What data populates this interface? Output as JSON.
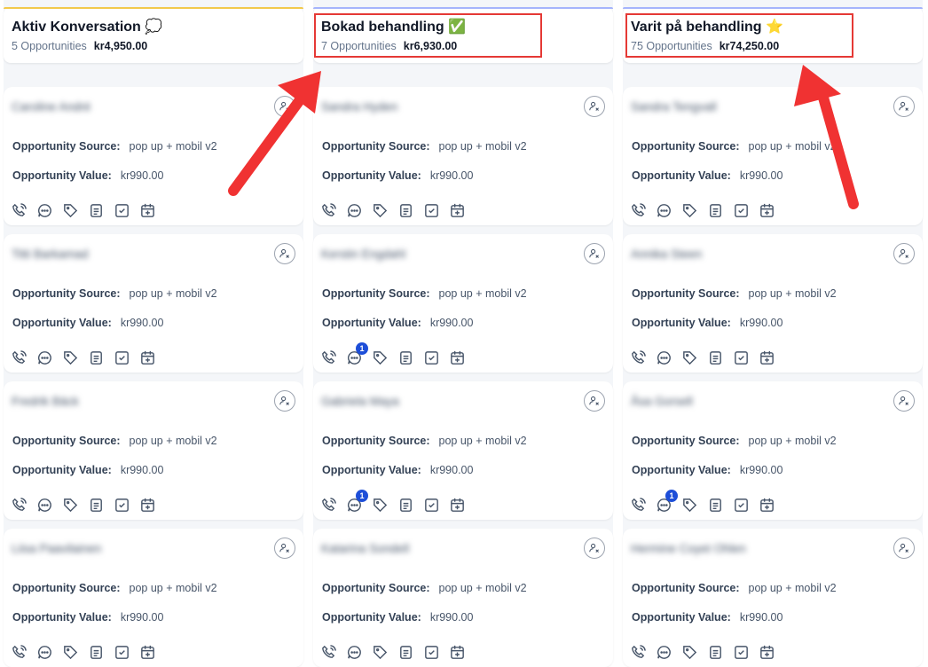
{
  "columns": [
    {
      "title": "Aktiv Konversation 💭",
      "count": "5 Opportunities",
      "total": "kr4,950.00",
      "accent": "#f2c94c",
      "cards": [
        {
          "name": "Caroline André",
          "source": "pop up + mobil v2",
          "value": "kr990.00",
          "badge": ""
        },
        {
          "name": "Titti Barkamad",
          "source": "pop up + mobil v2",
          "value": "kr990.00",
          "badge": ""
        },
        {
          "name": "Fredrik Bäck",
          "source": "pop up + mobil v2",
          "value": "kr990.00",
          "badge": ""
        },
        {
          "name": "Liisa Paavilainen",
          "source": "pop up + mobil v2",
          "value": "kr990.00",
          "badge": ""
        }
      ]
    },
    {
      "title": "Bokad behandling ✅",
      "count": "7 Opportunities",
      "total": "kr6,930.00",
      "accent": "#a5b4fc",
      "cards": [
        {
          "name": "Sandra Hyden",
          "source": "pop up + mobil v2",
          "value": "kr990.00",
          "badge": ""
        },
        {
          "name": "Kerstin Engdahl",
          "source": "pop up + mobil v2",
          "value": "kr990.00",
          "badge": "1"
        },
        {
          "name": "Gabriela Maya",
          "source": "pop up + mobil v2",
          "value": "kr990.00",
          "badge": "1"
        },
        {
          "name": "Katarina Sondell",
          "source": "pop up + mobil v2",
          "value": "kr990.00",
          "badge": ""
        }
      ]
    },
    {
      "title": "Varit på behandling ⭐",
      "count": "75 Opportunities",
      "total": "kr74,250.00",
      "accent": "#a5b4fc",
      "cards": [
        {
          "name": "Sandra Tengvall",
          "source": "pop up + mobil v2",
          "value": "kr990.00",
          "badge": ""
        },
        {
          "name": "Annika Steen",
          "source": "pop up + mobil v2",
          "value": "kr990.00",
          "badge": ""
        },
        {
          "name": "Åsa Gorsell",
          "source": "pop up + mobil v2",
          "value": "kr990.00",
          "badge": "1"
        },
        {
          "name": "Hermine Coyet Ohlen",
          "source": "pop up + mobil v2",
          "value": "kr990.00",
          "badge": ""
        }
      ]
    }
  ],
  "labels": {
    "source": "Opportunity Source:",
    "value": "Opportunity Value:"
  },
  "icons": [
    "phone-icon",
    "chat-icon",
    "tag-icon",
    "note-icon",
    "task-icon",
    "calendar-add-icon"
  ],
  "colors": {
    "highlight": "#e53935",
    "badge": "#1d4ed8"
  }
}
